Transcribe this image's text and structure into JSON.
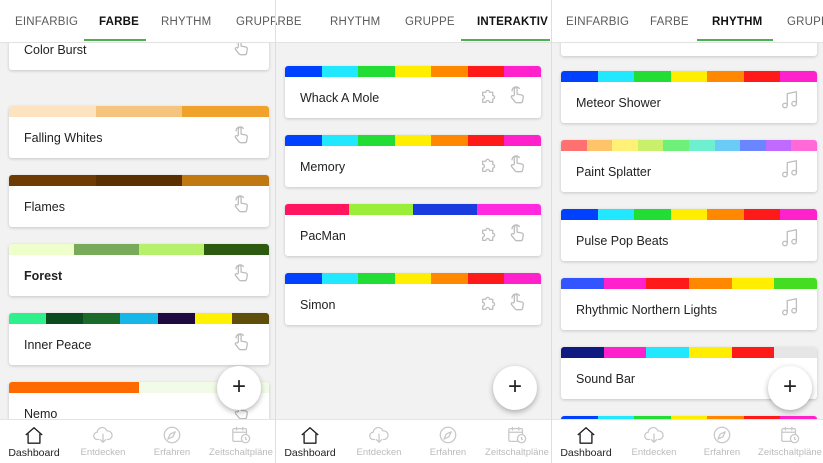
{
  "panels": [
    {
      "tabs": [
        {
          "label": "EINFARBIG",
          "active": false
        },
        {
          "label": "FARBE",
          "active": true
        },
        {
          "label": "RHYTHM",
          "active": false
        },
        {
          "label": "GRUPPE",
          "active": false
        }
      ],
      "cards": [
        {
          "name": "Color Burst",
          "bold": false,
          "icons": [
            "touch-icon"
          ],
          "colors": [
            "#0050ff",
            "#33ff22",
            "#ff6a00",
            "#9b1fff",
            "#ffe000",
            "#ff1fb4"
          ]
        },
        {
          "name": "Falling Whites",
          "bold": false,
          "icons": [
            "touch-icon"
          ],
          "colors": [
            "#fde3bf",
            "#f5c57e",
            "#f0a22c"
          ]
        },
        {
          "name": "Flames",
          "bold": false,
          "icons": [
            "touch-icon"
          ],
          "colors": [
            "#6e3b05",
            "#5a3000",
            "#c27810"
          ]
        },
        {
          "name": "Forest",
          "bold": true,
          "icons": [
            "touch-icon"
          ],
          "colors": [
            "#eeffcc",
            "#79aa5a",
            "#b7f06a",
            "#2c5a11"
          ]
        },
        {
          "name": "Inner Peace",
          "bold": false,
          "icons": [
            "touch-icon"
          ],
          "colors": [
            "#2ef08c",
            "#0c4a20",
            "#1b6a2a",
            "#16b7e8",
            "#1e0a3e",
            "#fff200",
            "#5e4e0a"
          ]
        },
        {
          "name": "Nemo",
          "bold": false,
          "icons": [
            "touch-icon"
          ],
          "colors": [
            "#ff6a00",
            "#f1fbe7"
          ]
        }
      ]
    },
    {
      "tabs": [
        {
          "label": "FARBE",
          "active": false
        },
        {
          "label": "RHYTHM",
          "active": false
        },
        {
          "label": "GRUPPE",
          "active": false
        },
        {
          "label": "INTERAKTIV",
          "active": true
        }
      ],
      "cards": [
        {
          "name": "Whack A Mole",
          "bold": false,
          "icons": [
            "puzzle-icon",
            "touch-icon"
          ],
          "colors": [
            "#0040ff",
            "#22e8ff",
            "#22dd33",
            "#ffee00",
            "#ff8800",
            "#ff1a1a",
            "#ff22cc"
          ]
        },
        {
          "name": "Memory",
          "bold": false,
          "icons": [
            "puzzle-icon",
            "touch-icon"
          ],
          "colors": [
            "#0040ff",
            "#22e8ff",
            "#22dd33",
            "#ffee00",
            "#ff8800",
            "#ff1a1a",
            "#ff22cc"
          ]
        },
        {
          "name": "PacMan",
          "bold": false,
          "icons": [
            "puzzle-icon",
            "touch-icon"
          ],
          "colors": [
            "#ff1560",
            "#9aee3a",
            "#1a3bdd",
            "#ff2ae0"
          ]
        },
        {
          "name": "Simon",
          "bold": false,
          "icons": [
            "puzzle-icon",
            "touch-icon"
          ],
          "colors": [
            "#0040ff",
            "#22e8ff",
            "#22dd33",
            "#ffee00",
            "#ff8800",
            "#ff1a1a",
            "#ff22cc"
          ]
        }
      ]
    },
    {
      "tabs": [
        {
          "label": "EINFARBIG",
          "active": false
        },
        {
          "label": "FARBE",
          "active": false
        },
        {
          "label": "RHYTHM",
          "active": true
        },
        {
          "label": "GRUPPE",
          "active": false
        }
      ],
      "cards": [
        {
          "name": "Meteor Shower",
          "bold": false,
          "icons": [
            "music-note-icon"
          ],
          "colors": [
            "#0040ff",
            "#22e8ff",
            "#22dd33",
            "#ffee00",
            "#ff8800",
            "#ff1a1a",
            "#ff22cc"
          ]
        },
        {
          "name": "Paint Splatter",
          "bold": false,
          "icons": [
            "music-note-icon"
          ],
          "colors": [
            "#ff7070",
            "#ffc46a",
            "#fff176",
            "#c9f06a",
            "#6ef07a",
            "#6ef0d0",
            "#6acbf6",
            "#6a86ff",
            "#c06aff",
            "#ff6ad8"
          ]
        },
        {
          "name": "Pulse Pop Beats",
          "bold": false,
          "icons": [
            "music-note-icon"
          ],
          "colors": [
            "#0040ff",
            "#22e8ff",
            "#22dd33",
            "#ffee00",
            "#ff8800",
            "#ff1a1a",
            "#ff22cc"
          ]
        },
        {
          "name": "Rhythmic Northern Lights",
          "bold": false,
          "icons": [
            "music-note-icon"
          ],
          "colors": [
            "#3355ff",
            "#ff22cc",
            "#ff1a1a",
            "#ff8800",
            "#ffee00",
            "#44dd22"
          ]
        },
        {
          "name": "Sound Bar",
          "bold": false,
          "icons": [
            "music-note-icon"
          ],
          "colors": [
            "#101a80",
            "#ff22cc",
            "#22e8ff",
            "#ffee00",
            "#ff1a1a",
            "#e6e6e6"
          ]
        },
        {
          "name": "",
          "bold": false,
          "icons": [],
          "colors": [
            "#0040ff",
            "#22e8ff",
            "#22dd33",
            "#ffee00",
            "#ff8800",
            "#ff1a1a",
            "#ff22cc"
          ]
        }
      ]
    }
  ],
  "fab_label": "+",
  "bottom_nav": [
    {
      "label": "Dashboard",
      "icon": "home-icon",
      "active": true
    },
    {
      "label": "Entdecken",
      "icon": "cloud-download-icon",
      "active": false
    },
    {
      "label": "Erfahren",
      "icon": "compass-icon",
      "active": false
    },
    {
      "label": "Zeitschaltpläne",
      "icon": "calendar-clock-icon",
      "active": false
    }
  ],
  "colors": {
    "accent": "#4caf50",
    "card_bg": "#ffffff",
    "background": "#f2f2f2"
  }
}
